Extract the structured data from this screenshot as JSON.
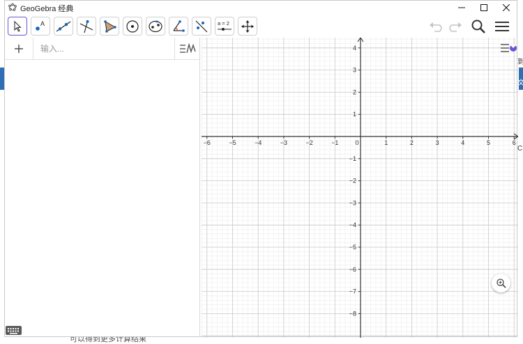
{
  "window": {
    "title": "GeoGebra 经典"
  },
  "algebra": {
    "input_placeholder": "输入..."
  },
  "toolbar": {
    "tools": [
      {
        "name": "move-tool",
        "icon": "arrow-cursor-icon",
        "selected": true
      },
      {
        "name": "point-tool",
        "icon": "point-icon"
      },
      {
        "name": "line-tool",
        "icon": "line-through-points-icon"
      },
      {
        "name": "perpendicular-tool",
        "icon": "perpendicular-line-icon"
      },
      {
        "name": "polygon-tool",
        "icon": "polygon-icon"
      },
      {
        "name": "circle-tool",
        "icon": "circle-center-point-icon"
      },
      {
        "name": "ellipse-tool",
        "icon": "ellipse-icon"
      },
      {
        "name": "angle-tool",
        "icon": "angle-icon"
      },
      {
        "name": "reflect-tool",
        "icon": "reflect-about-line-icon"
      },
      {
        "name": "slider-tool",
        "icon": "slider-icon",
        "label": "a = 2"
      },
      {
        "name": "move-view-tool",
        "icon": "move-graphics-view-icon"
      }
    ]
  },
  "graph": {
    "x_range": [
      -6,
      6
    ],
    "y_range": [
      -8,
      4
    ],
    "x_tick_labels": [
      "-6",
      "-5",
      "-4",
      "-3",
      "-2",
      "-1",
      "0",
      "1",
      "2",
      "3",
      "4",
      "5",
      "6"
    ],
    "y_tick_labels": [
      "4",
      "3",
      "2",
      "1",
      "-1",
      "-2",
      "-3",
      "-4",
      "-5",
      "-6",
      "-7",
      "-8"
    ],
    "grid": true,
    "axis_color": "#333333",
    "major_grid_color": "#c8c8c8",
    "minor_grid_color": "#ececec"
  },
  "background": {
    "bottom_text": "可以得到更多计算结果",
    "right_fragments": [
      "到",
      "文",
      "C"
    ]
  },
  "colors": {
    "accent": "#6557d2",
    "icon_blue": "#1565c0",
    "polygon_fill": "#c8a07a"
  }
}
